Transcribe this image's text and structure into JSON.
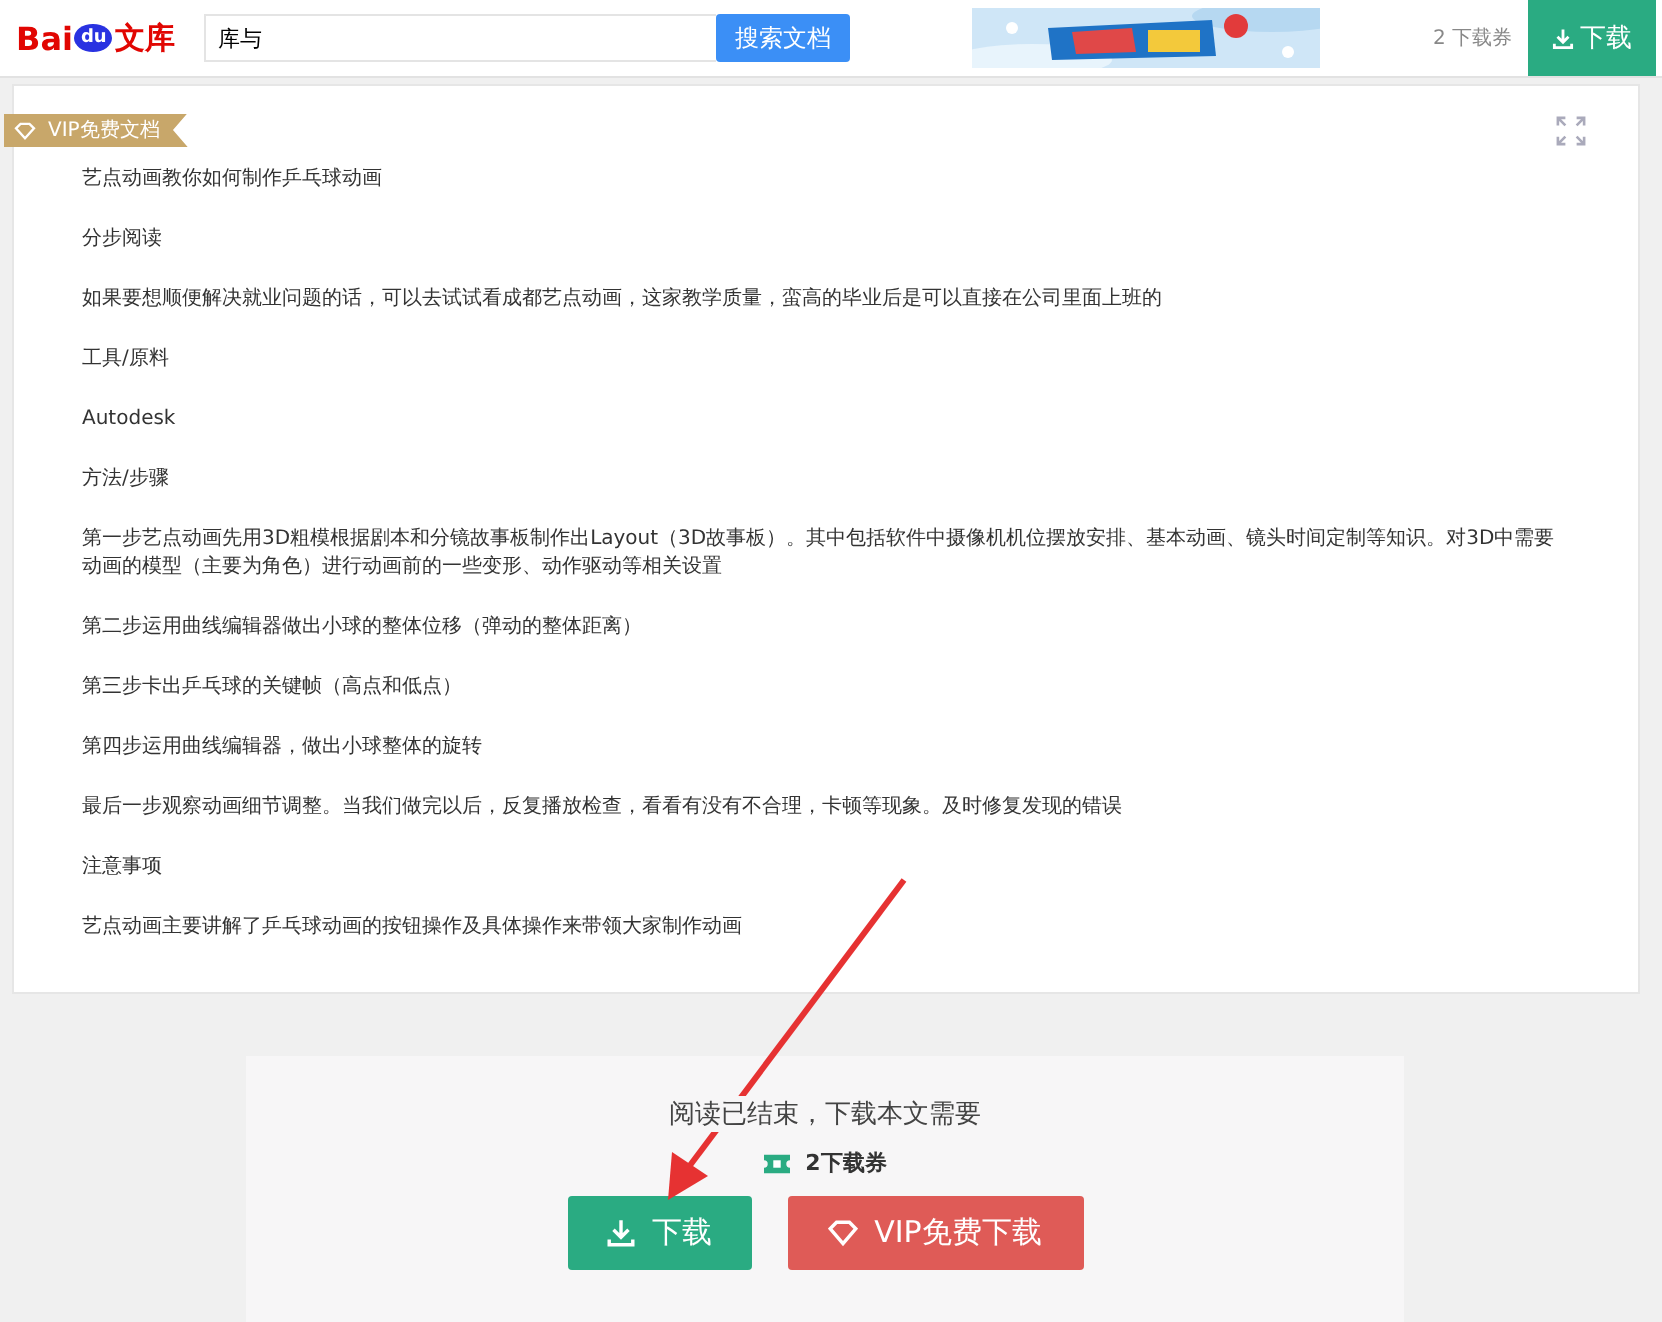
{
  "header": {
    "logo": {
      "left": "Bai",
      "paw": "du",
      "right": "文库"
    },
    "search": {
      "value": "库与",
      "button": "搜索文档"
    },
    "coupon_count": "2 下载券",
    "download_button": "下载"
  },
  "document": {
    "badge": "VIP免费文档",
    "paragraphs": [
      "艺点动画教你如何制作乒乓球动画",
      "分步阅读",
      "如果要想顺便解决就业问题的话，可以去试试看成都艺点动画，这家教学质量，蛮高的毕业后是可以直接在公司里面上班的",
      "工具/原料",
      "Autodesk",
      "方法/步骤",
      "第一步艺点动画先用3D粗模根据剧本和分镜故事板制作出Layout（3D故事板）。其中包括软件中摄像机机位摆放安排、基本动画、镜头时间定制等知识。对3D中需要动画的模型（主要为角色）进行动画前的一些变形、动作驱动等相关设置",
      "第二步运用曲线编辑器做出小球的整体位移（弹动的整体距离）",
      "第三步卡出乒乓球的关键帧（高点和低点）",
      "第四步运用曲线编辑器，做出小球整体的旋转",
      "最后一步观察动画细节调整。当我们做完以后，反复播放检查，看看有没有不合理，卡顿等现象。及时修复发现的错误",
      "注意事项",
      "艺点动画主要讲解了乒乓球动画的按钮操作及具体操作来带领大家制作动画"
    ]
  },
  "end_panel": {
    "message": "阅读已结束，下载本文需要",
    "cost": "2下载券",
    "buttons": [
      {
        "kind": "download",
        "label": "下载"
      },
      {
        "kind": "vip",
        "label": "VIP免费下载"
      }
    ]
  }
}
